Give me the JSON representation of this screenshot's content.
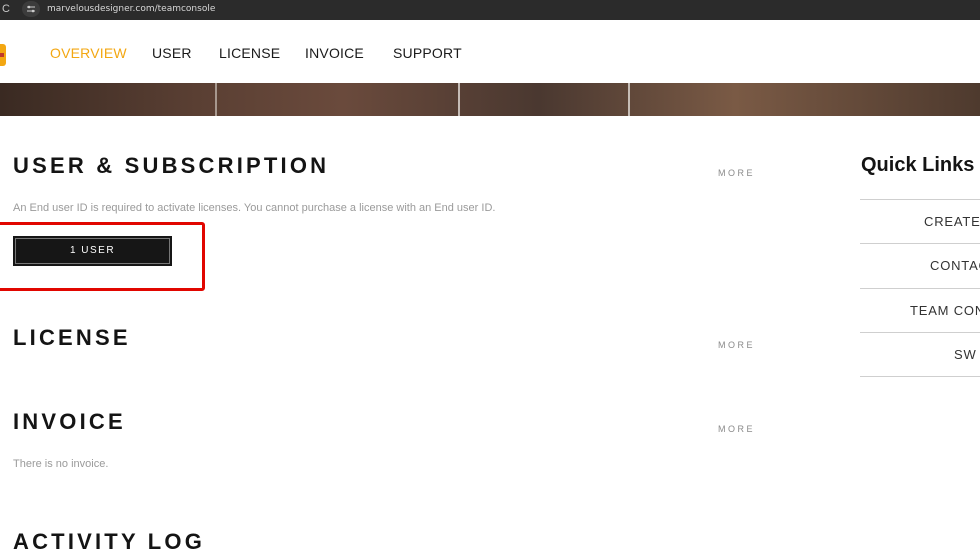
{
  "browser": {
    "url": "marvelousdesigner.com/teamconsole",
    "reload_glyph": "C"
  },
  "nav": {
    "items": [
      {
        "label": "OVERVIEW"
      },
      {
        "label": "USER"
      },
      {
        "label": "LICENSE"
      },
      {
        "label": "INVOICE"
      },
      {
        "label": "SUPPORT"
      }
    ],
    "active_color": "#f3a712"
  },
  "user_subscription": {
    "title": "USER & SUBSCRIPTION",
    "more": "MORE",
    "description": "An End user ID is required to activate licenses. You cannot purchase a license with an End user ID.",
    "user_button": "1 USER"
  },
  "license": {
    "title": "LICENSE",
    "more": "MORE"
  },
  "invoice": {
    "title": "INVOICE",
    "more": "MORE",
    "empty_text": "There is no invoice."
  },
  "activity_log": {
    "title": "ACTIVITY LOG"
  },
  "quick_links": {
    "title": "Quick Links",
    "items": [
      {
        "label": "CREATE"
      },
      {
        "label": "CONTAC"
      },
      {
        "label": "TEAM CON"
      },
      {
        "label": "SW"
      }
    ]
  },
  "annotation": {
    "highlight_color": "#e10600"
  }
}
